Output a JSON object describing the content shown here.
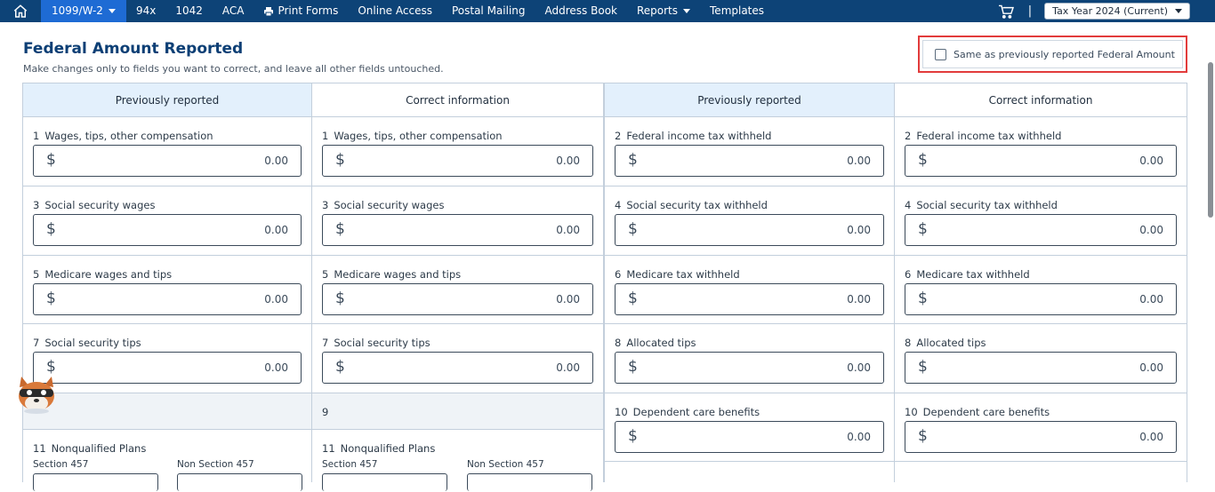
{
  "nav": {
    "items": [
      {
        "label": "1099/W-2",
        "has_caret": true,
        "active": true
      },
      {
        "label": "94x"
      },
      {
        "label": "1042"
      },
      {
        "label": "ACA"
      },
      {
        "label": "Print Forms",
        "icon": "printer-icon"
      },
      {
        "label": "Online Access"
      },
      {
        "label": "Postal Mailing"
      },
      {
        "label": "Address Book"
      },
      {
        "label": "Reports",
        "has_caret": true
      },
      {
        "label": "Templates"
      }
    ],
    "separator": "|",
    "tax_year": "Tax Year 2024 (Current)"
  },
  "header": {
    "title": "Federal Amount Reported",
    "subtitle": "Make changes only to fields you want to correct, and leave all other fields untouched.",
    "same_as_label": "Same as previously reported Federal Amount"
  },
  "columns": {
    "col1": "Previously reported",
    "col2": "Correct information",
    "col3": "Previously reported",
    "col4": "Correct information"
  },
  "boxes": {
    "b1": {
      "num": "1",
      "label": "Wages, tips, other compensation"
    },
    "b2": {
      "num": "2",
      "label": "Federal income tax withheld"
    },
    "b3": {
      "num": "3",
      "label": "Social security wages"
    },
    "b4": {
      "num": "4",
      "label": "Social security tax withheld"
    },
    "b5": {
      "num": "5",
      "label": "Medicare wages and tips"
    },
    "b6": {
      "num": "6",
      "label": "Medicare tax withheld"
    },
    "b7": {
      "num": "7",
      "label": "Social security tips"
    },
    "b8": {
      "num": "8",
      "label": "Allocated tips"
    },
    "b9": {
      "num": "9"
    },
    "b10": {
      "num": "10",
      "label": "Dependent care benefits"
    },
    "b11": {
      "num": "11",
      "label": "Nonqualified Plans",
      "sub1": "Section 457",
      "sub2": "Non Section 457"
    }
  },
  "currency": "$",
  "amount_value": "0.00"
}
